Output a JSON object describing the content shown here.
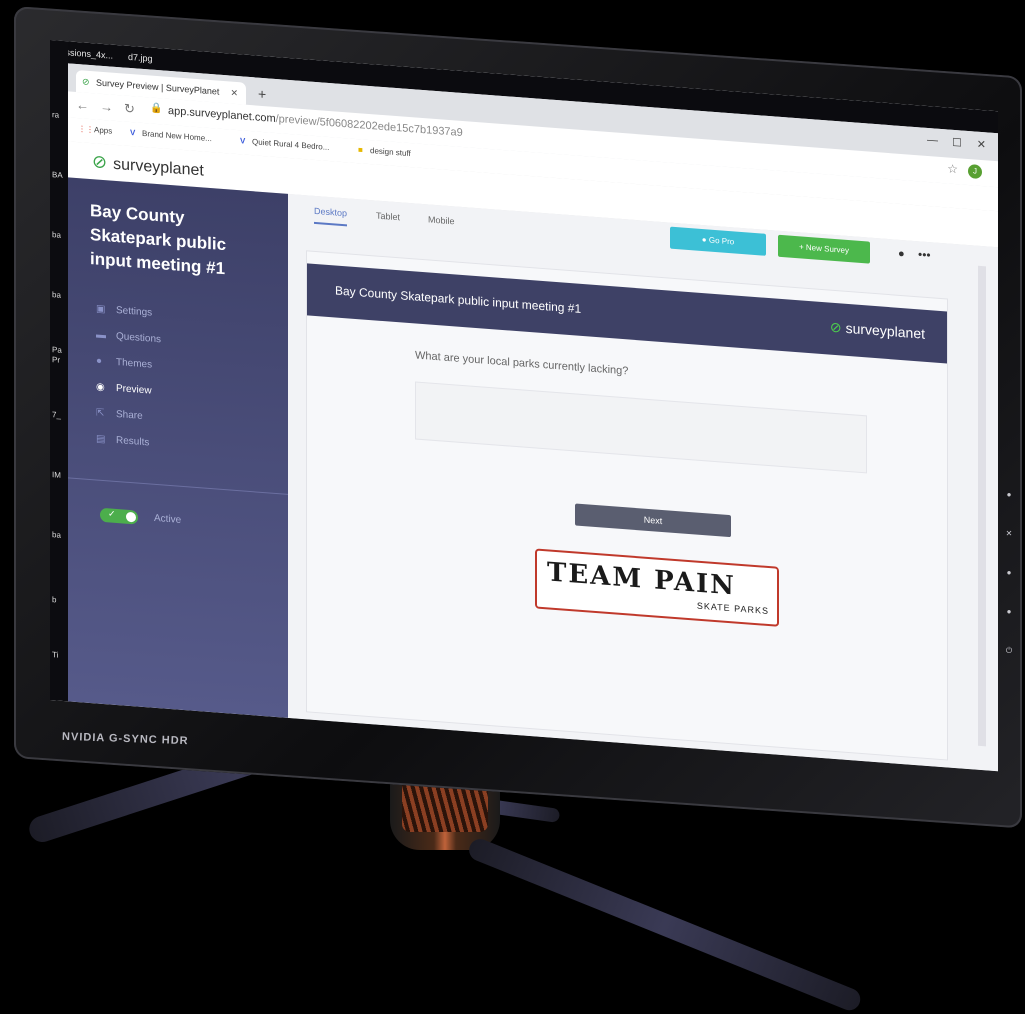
{
  "desktop": {
    "top_files": [
      "sessions_4x...",
      "d7.jpg"
    ],
    "side_labels": [
      "ra",
      "BA",
      "ba",
      "ba",
      "Pa",
      "Pr",
      "7_",
      "IM",
      "ba",
      "b",
      "Ti"
    ]
  },
  "monitor": {
    "brand": "NVIDIA G-SYNC HDR"
  },
  "browser": {
    "tab_title": "Survey Preview | SurveyPlanet",
    "url_host": "app.surveyplanet.com",
    "url_path": "/preview/5f06082202ede15c7b1937a9",
    "bookmarks": [
      "Apps",
      "Brand New Home...",
      "Quiet Rural 4 Bedro...",
      "design stuff"
    ],
    "profile_initial": "J"
  },
  "app": {
    "logo_text": "surveyplanet",
    "survey_name": "Bay County Skatepark public input meeting #1",
    "nav": [
      {
        "label": "Settings",
        "icon": "settings-icon"
      },
      {
        "label": "Questions",
        "icon": "questions-icon"
      },
      {
        "label": "Themes",
        "icon": "themes-icon"
      },
      {
        "label": "Preview",
        "icon": "preview-icon",
        "active": true
      },
      {
        "label": "Share",
        "icon": "share-icon"
      },
      {
        "label": "Results",
        "icon": "results-icon"
      }
    ],
    "status_label": "Active",
    "view_tabs": [
      "Desktop",
      "Tablet",
      "Mobile"
    ],
    "go_pro_label": "Go Pro",
    "new_survey_label": "+ New Survey"
  },
  "preview": {
    "header_title": "Bay County Skatepark public input meeting #1",
    "header_logo": "surveyplanet",
    "question": "What are your local parks currently lacking?",
    "answer_value": "",
    "next_label": "Next",
    "logo_main": "TEAM PAIN",
    "logo_sub": "SKATE PARKS"
  },
  "colors": {
    "sidebar": "#3d4068",
    "survey_header": "#3e4166",
    "go_pro": "#3cc0d6",
    "new_survey": "#4cb84c",
    "brand_green": "#3ba44a"
  }
}
